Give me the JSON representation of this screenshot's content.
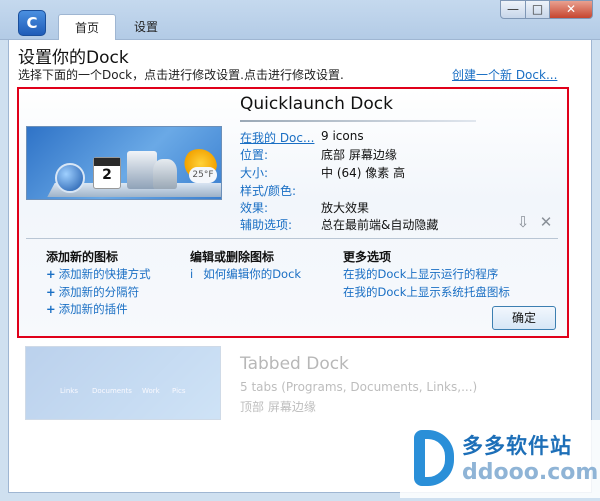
{
  "window": {
    "tabs": [
      {
        "label": "首页"
      },
      {
        "label": "设置"
      }
    ],
    "controls": {
      "minimize": "—",
      "maximize": "□",
      "close": "✕"
    },
    "logo_glyph": "C",
    "accent": "#1a6fc4"
  },
  "header": {
    "title": "设置你的Dock",
    "subtitle": "选择下面的一个Dock，点击进行修改设置.点击进行修改设置.",
    "create_link": "创建一个新 Dock..."
  },
  "selected_dock": {
    "name": "Quicklaunch Dock",
    "preview_calendar_day": "2",
    "preview_weather_text": "25°F",
    "info": [
      {
        "label": "在我的 Doc...",
        "value": "9 icons",
        "is_link": true
      },
      {
        "label": "位置:",
        "value": "底部 屏幕边缘"
      },
      {
        "label": "大小:",
        "value": "中 (64) 像素 高"
      },
      {
        "label": "样式/颜色:",
        "value": ""
      },
      {
        "label": "效果:",
        "value": "放大效果"
      },
      {
        "label": "辅助选项:",
        "value": "总在最前端&自动隐藏"
      }
    ],
    "actions": {
      "download_icon": "⇩",
      "delete_icon": "✕"
    },
    "sections": {
      "add": {
        "heading": "添加新的图标",
        "links": [
          "添加新的快捷方式",
          "添加新的分隔符",
          "添加新的插件"
        ]
      },
      "edit": {
        "heading": "编辑或删除图标",
        "info_glyph": "i",
        "links": [
          "如何编辑你的Dock"
        ]
      },
      "more": {
        "heading": "更多选项",
        "links": [
          "在我的Dock上显示运行的程序",
          "在我的Dock上显示系统托盘图标"
        ]
      }
    },
    "ok_button": "确定",
    "highlight_color": "#e0001a"
  },
  "other_dock": {
    "name": "Tabbed Dock",
    "tabs_line": "5 tabs (Programs, Documents, Links,...)",
    "position_line": "顶部 屏幕边缘",
    "preview_tabs": [
      "Links",
      "Documents",
      "Work",
      "Pics"
    ]
  },
  "watermark": {
    "title": "多多软件站",
    "url": "ddooo.com"
  }
}
